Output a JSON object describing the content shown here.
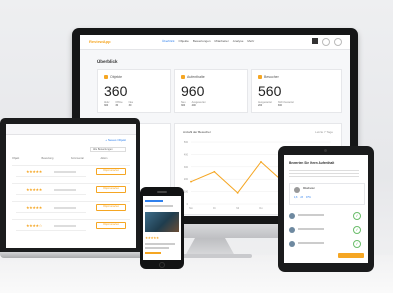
{
  "monitor": {
    "logo_main": "ReviewApp",
    "logo_accent": "",
    "nav": [
      "Überblick",
      "Objekte",
      "Bewertungen",
      "Mitarbeiter",
      "Analyse",
      "Mehr"
    ],
    "page_title": "Überblick",
    "stats": [
      {
        "label": "Objekte",
        "value": "360",
        "sub": [
          {
            "k": "Aktiv",
            "v": "300"
          },
          {
            "k": "Offline",
            "v": "30"
          },
          {
            "k": "Neu",
            "v": "30"
          }
        ]
      },
      {
        "label": "Aufenthalte",
        "value": "960",
        "sub": [
          {
            "k": "Neu",
            "v": "300"
          },
          {
            "k": "Ausgewertet",
            "v": "400"
          }
        ]
      },
      {
        "label": "Besucher",
        "value": "560",
        "sub": [
          {
            "k": "Ausgewertet",
            "v": "200"
          },
          {
            "k": "Nicht bewertet",
            "v": "300"
          }
        ]
      }
    ],
    "chart_title": "Anzahl der Besucher",
    "chart_range": "Letzte 7 Tage"
  },
  "chart_data": {
    "type": "line",
    "categories": [
      "Mo",
      "Di",
      "Mi",
      "Do",
      "Fr",
      "Sa",
      "So"
    ],
    "series": [
      {
        "values": [
          180,
          260,
          90,
          340,
          170,
          420,
          230
        ]
      }
    ],
    "ylim": [
      0,
      500
    ],
    "grid": true,
    "legend": "none",
    "color": "#f5a623"
  },
  "laptop": {
    "top_link": "+ Neues Objekt",
    "select_value": "Alle Bewertungen",
    "columns": [
      "Objekt",
      "Bewertung",
      "Kommentar",
      "Aktion"
    ],
    "rows": [
      {
        "stars": "★★★★★",
        "action": "Objekt ansehen"
      },
      {
        "stars": "★★★★★",
        "action": "Objekt ansehen"
      },
      {
        "stars": "★★★★★",
        "action": "Objekt ansehen"
      },
      {
        "stars": "★★★★☆",
        "action": "Objekt ansehen"
      }
    ]
  },
  "phone": {
    "stars": "★★★★★"
  },
  "tablet": {
    "title_main": "Bewerten Sie Ihren Aufenthalt",
    "title_accent": "",
    "card_name": "Mitarbeiter",
    "card_stats": [
      "4,8",
      "23",
      "97%"
    ],
    "check": "✓"
  },
  "colors": {
    "accent": "#f5a623",
    "primary": "#2f80ed",
    "positive": "#6abd6a"
  }
}
